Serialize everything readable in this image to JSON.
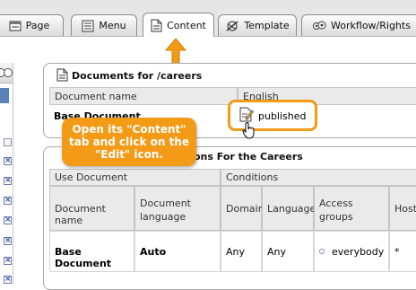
{
  "tabs": [
    {
      "label": "Page",
      "icon": "page-icon"
    },
    {
      "label": "Menu",
      "icon": "menu-icon"
    },
    {
      "label": "Content",
      "icon": "content-icon",
      "active": true
    },
    {
      "label": "Template",
      "icon": "template-icon"
    },
    {
      "label": "Workflow/Rights",
      "icon": "workflow-icon"
    }
  ],
  "documents_panel": {
    "title": "Documents for /careers",
    "col_document_name": "Document name",
    "col_language": "English",
    "row_document": "Base Document",
    "status": "published"
  },
  "conditions_panel": {
    "title_suffix": "ons For the Careers",
    "group_use_document": "Use Document",
    "group_conditions": "Conditions",
    "headers": [
      "Document name",
      "Document language",
      "Domain",
      "Language",
      "Access groups",
      "Host"
    ],
    "row": {
      "document_name": "Base Document",
      "document_language": "Auto",
      "domain": "Any",
      "language": "Any",
      "access_groups": "everybody",
      "host": "*"
    }
  },
  "callout": {
    "text": "Open its \"Content\" tab and click on the \"Edit\" icon."
  },
  "colors": {
    "accent": "#f39a17",
    "tab_bar": "#e6e6e6",
    "header_bg": "#eaeaea"
  }
}
